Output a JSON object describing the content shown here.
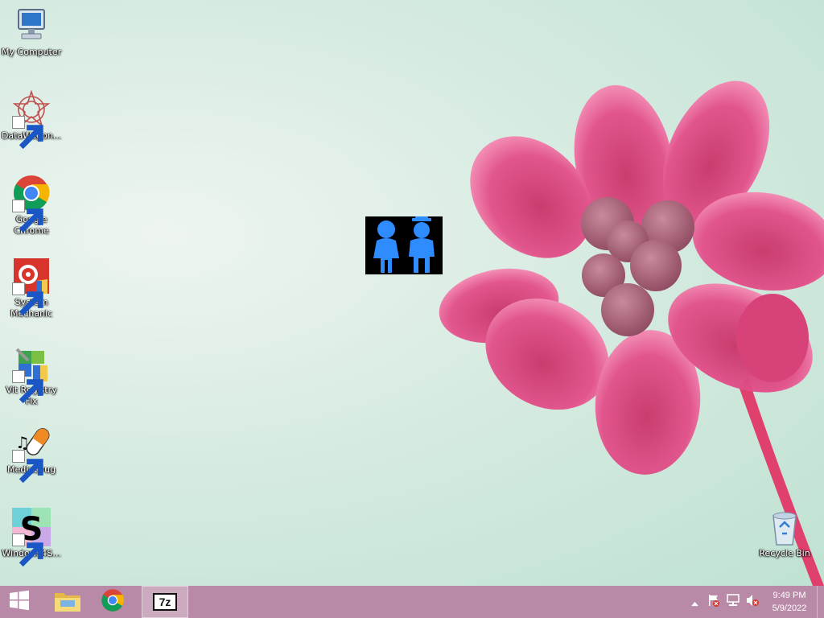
{
  "desktop": {
    "icons": [
      {
        "label": "My Computer",
        "icon": "computer-icon"
      },
      {
        "label": "DataWagon...",
        "icon": "datawagon-icon"
      },
      {
        "label": "Google Chrome",
        "icon": "chrome-icon"
      },
      {
        "label": "System Mechanic",
        "icon": "system-mechanic-icon"
      },
      {
        "label": "Vit Registry Fix",
        "icon": "vit-registry-fix-icon"
      },
      {
        "label": "MediaDrug",
        "icon": "mediadrug-icon"
      },
      {
        "label": "Windows4S...",
        "icon": "windows4s-icon"
      },
      {
        "label": "Recycle Bin",
        "icon": "recycle-bin-icon"
      }
    ],
    "center_logo": "two-people-logo"
  },
  "taskbar": {
    "pinned": [
      {
        "icon": "windows-start-icon"
      },
      {
        "icon": "file-explorer-icon"
      },
      {
        "icon": "chrome-icon"
      },
      {
        "icon": "7zip-icon",
        "text": "7z",
        "active": true
      }
    ],
    "tray": {
      "icons": [
        "chevron-up-icon",
        "action-center-flag-icon",
        "network-icon",
        "volume-muted-icon"
      ],
      "time": "9:49 PM",
      "date": "5/9/2022"
    }
  },
  "colors": {
    "taskbar": "#b98aa7",
    "flower": "#e0457f",
    "logo_blue": "#2f8cff"
  }
}
